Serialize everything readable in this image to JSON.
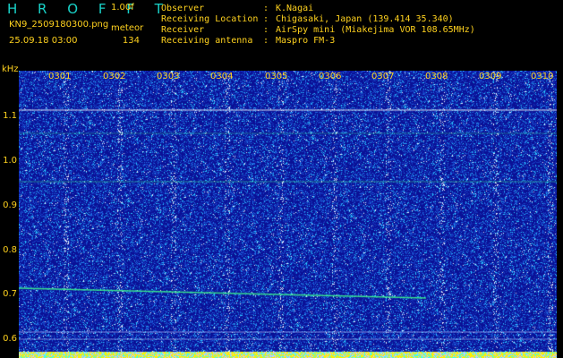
{
  "header": {
    "brand": "H R O F F T",
    "version": "1.00f",
    "filename": "KN9_2509180300.png",
    "mode": "meteor",
    "datetime": "25.09.18 03:00",
    "count": "134"
  },
  "meta": [
    {
      "key": "Observer",
      "colon": ":",
      "value": "K.Nagai"
    },
    {
      "key": "Receiving Location",
      "colon": ":",
      "value": "Chigasaki, Japan (139.414 35.340)"
    },
    {
      "key": "Receiver",
      "colon": ":",
      "value": "AirSpy mini (Miakejima VOR 108.65MHz)"
    },
    {
      "key": "Receiving antenna",
      "colon": ":",
      "value": "Maspro FM-3"
    }
  ],
  "axis": {
    "ylabel": "kHz",
    "yticks": [
      {
        "label": "1.1",
        "value": 1.1
      },
      {
        "label": "1.0",
        "value": 1.0
      },
      {
        "label": "0.9",
        "value": 0.9
      },
      {
        "label": "0.8",
        "value": 0.8
      },
      {
        "label": "0.7",
        "value": 0.7
      },
      {
        "label": "0.6",
        "value": 0.6
      }
    ],
    "xticks": [
      {
        "label": "0301",
        "minute": 1
      },
      {
        "label": "0302",
        "minute": 2
      },
      {
        "label": "0303",
        "minute": 3
      },
      {
        "label": "0304",
        "minute": 4
      },
      {
        "label": "0305",
        "minute": 5
      },
      {
        "label": "0306",
        "minute": 6
      },
      {
        "label": "0307",
        "minute": 7
      },
      {
        "label": "0308",
        "minute": 8
      },
      {
        "label": "0309",
        "minute": 9
      },
      {
        "label": "0310",
        "minute": 10
      }
    ]
  },
  "colors": {
    "background": "#000000",
    "label": "#ffd21e",
    "brand": "#19d2c8",
    "spectrum_bg": "#0a1196",
    "carrier": "#ffffff",
    "echo": "#3dff8a"
  }
}
